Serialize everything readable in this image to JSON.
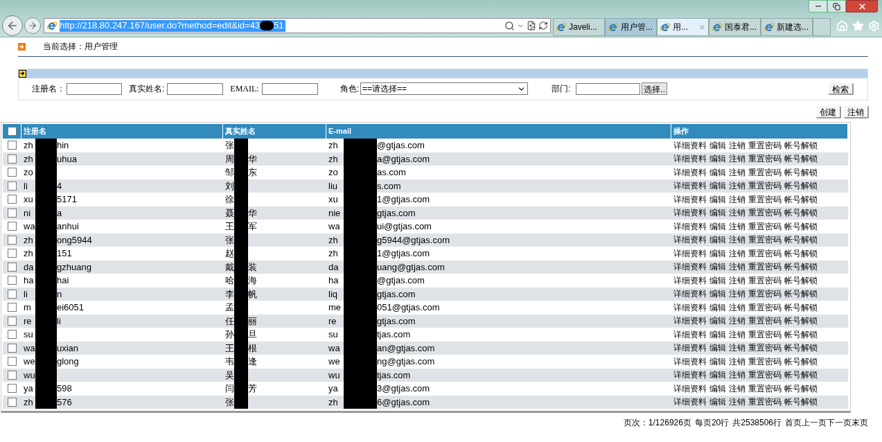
{
  "address_bar": {
    "url_before": "http://218.80.247.167/user.do?method=edit&id=43",
    "url_after": "51"
  },
  "tabs": [
    {
      "label": "Javeli...",
      "selected": false,
      "closable": false
    },
    {
      "label": "用户管...",
      "selected": false,
      "closable": false
    },
    {
      "label": "用...",
      "selected": true,
      "closable": true
    },
    {
      "label": "国泰君...",
      "selected": false,
      "closable": false
    },
    {
      "label": "新建选...",
      "selected": false,
      "closable": false
    }
  ],
  "breadcrumb": "当前选择：用户管理",
  "filters": [
    {
      "kind": "text",
      "label": "注册名："
    },
    {
      "kind": "text",
      "label": "真实姓名:"
    },
    {
      "kind": "text",
      "label": "EMAIL:"
    },
    {
      "kind": "select",
      "label": "角色:",
      "value": "==请选择=="
    },
    {
      "kind": "picker",
      "label": "部门:",
      "button": "选择.."
    }
  ],
  "search_button": "检索",
  "action_buttons": [
    "创建",
    "注销"
  ],
  "table": {
    "columns": [
      "注册名",
      "真实姓名",
      "E-mail",
      "操作"
    ],
    "header_checked": false,
    "rows": [
      {
        "checked": false,
        "cells": [
          {
            "before": "zh",
            "after": "hin"
          },
          {
            "before": "张"
          },
          {
            "before": "zh",
            "after": "@gtjas.com"
          }
        ],
        "actions": [
          "详细资料",
          "编辑",
          "注销",
          "重置密码",
          "帐号解锁"
        ]
      },
      {
        "checked": false,
        "cells": [
          {
            "before": "zh",
            "after": "uhua"
          },
          {
            "before": "周",
            "after": "华"
          },
          {
            "before": "zh",
            "after": "a@gtjas.com"
          }
        ],
        "actions": [
          "详细资料",
          "编辑",
          "注销",
          "重置密码",
          "帐号解锁"
        ]
      },
      {
        "checked": false,
        "cells": [
          {
            "before": "zo"
          },
          {
            "before": "邹",
            "after": "东"
          },
          {
            "before": "zo",
            "after": "as.com"
          }
        ],
        "actions": [
          "详细资料",
          "编辑",
          "注销",
          "重置密码",
          "帐号解锁"
        ]
      },
      {
        "checked": false,
        "cells": [
          {
            "before": "li",
            "after": "4"
          },
          {
            "before": "刘"
          },
          {
            "before": "liu",
            "after": "s.com"
          }
        ],
        "actions": [
          "详细资料",
          "编辑",
          "注销",
          "重置密码",
          "帐号解锁"
        ]
      },
      {
        "checked": false,
        "cells": [
          {
            "before": "xu",
            "after": "5171"
          },
          {
            "before": "徐"
          },
          {
            "before": "xu",
            "after": "1@gtjas.com"
          }
        ],
        "actions": [
          "详细资料",
          "编辑",
          "注销",
          "重置密码",
          "帐号解锁"
        ]
      },
      {
        "checked": false,
        "cells": [
          {
            "before": "ni",
            "after": "a"
          },
          {
            "before": "聂",
            "after": "华"
          },
          {
            "before": "nie",
            "after": "gtjas.com"
          }
        ],
        "actions": [
          "详细资料",
          "编辑",
          "注销",
          "重置密码",
          "帐号解锁"
        ]
      },
      {
        "checked": false,
        "cells": [
          {
            "before": "wa",
            "after": "anhui"
          },
          {
            "before": "王",
            "after": "军"
          },
          {
            "before": "wa",
            "after": "ui@gtjas.com"
          }
        ],
        "actions": [
          "详细资料",
          "编辑",
          "注销",
          "重置密码",
          "帐号解锁"
        ]
      },
      {
        "checked": false,
        "cells": [
          {
            "before": "zh",
            "after": "ong5944"
          },
          {
            "before": "张"
          },
          {
            "before": "zh",
            "after": "g5944@gtjas.com"
          }
        ],
        "actions": [
          "详细资料",
          "编辑",
          "注销",
          "重置密码",
          "帐号解锁"
        ]
      },
      {
        "checked": false,
        "cells": [
          {
            "before": "zh",
            "after": "151"
          },
          {
            "before": "赵"
          },
          {
            "before": "zh",
            "after": "1@gtjas.com"
          }
        ],
        "actions": [
          "详细资料",
          "编辑",
          "注销",
          "重置密码",
          "帐号解锁"
        ]
      },
      {
        "checked": false,
        "cells": [
          {
            "before": "da",
            "after": "gzhuang"
          },
          {
            "before": "戴",
            "after": "装"
          },
          {
            "before": "da",
            "after": "uang@gtjas.com"
          }
        ],
        "actions": [
          "详细资料",
          "编辑",
          "注销",
          "重置密码",
          "帐号解锁"
        ]
      },
      {
        "checked": false,
        "cells": [
          {
            "before": "ha",
            "after": "hai"
          },
          {
            "before": "哈",
            "after": "海"
          },
          {
            "before": "ha",
            "after": "@gtjas.com"
          }
        ],
        "actions": [
          "详细资料",
          "编辑",
          "注销",
          "重置密码",
          "帐号解锁"
        ]
      },
      {
        "checked": false,
        "cells": [
          {
            "before": "li",
            "after": "n"
          },
          {
            "before": "李",
            "after": "帆"
          },
          {
            "before": "liq",
            "after": "gtjas.com"
          }
        ],
        "actions": [
          "详细资料",
          "编辑",
          "注销",
          "重置密码",
          "帐号解锁"
        ]
      },
      {
        "checked": false,
        "cells": [
          {
            "before": "m",
            "after": "ei6051"
          },
          {
            "before": "孟"
          },
          {
            "before": "me",
            "after": "051@gtjas.com"
          }
        ],
        "actions": [
          "详细资料",
          "编辑",
          "注销",
          "重置密码",
          "帐号解锁"
        ]
      },
      {
        "checked": false,
        "cells": [
          {
            "before": "re",
            "after": "li"
          },
          {
            "before": "任",
            "after": "丽"
          },
          {
            "before": "re",
            "after": "gtjas.com"
          }
        ],
        "actions": [
          "详细资料",
          "编辑",
          "注销",
          "重置密码",
          "帐号解锁"
        ]
      },
      {
        "checked": false,
        "cells": [
          {
            "before": "su"
          },
          {
            "before": "孙",
            "after": "旦"
          },
          {
            "before": "su",
            "after": "tjas.com"
          }
        ],
        "actions": [
          "详细资料",
          "编辑",
          "注销",
          "重置密码",
          "帐号解锁"
        ]
      },
      {
        "checked": false,
        "cells": [
          {
            "before": "wa",
            "after": "uxian"
          },
          {
            "before": "王",
            "after": "根"
          },
          {
            "before": "wa",
            "after": "an@gtjas.com"
          }
        ],
        "actions": [
          "详细资料",
          "编辑",
          "注销",
          "重置密码",
          "帐号解锁"
        ]
      },
      {
        "checked": false,
        "cells": [
          {
            "before": "we",
            "after": "glong"
          },
          {
            "before": "韦",
            "after": "逢"
          },
          {
            "before": "we",
            "after": "ng@gtjas.com"
          }
        ],
        "actions": [
          "详细资料",
          "编辑",
          "注销",
          "重置密码",
          "帐号解锁"
        ]
      },
      {
        "checked": false,
        "cells": [
          {
            "before": "wu"
          },
          {
            "before": "吴"
          },
          {
            "before": "wu",
            "after": "tjas.com"
          }
        ],
        "actions": [
          "详细资料",
          "编辑",
          "注销",
          "重置密码",
          "帐号解锁"
        ]
      },
      {
        "checked": false,
        "cells": [
          {
            "before": "ya",
            "after": "598"
          },
          {
            "before": "闫",
            "after": "芳"
          },
          {
            "before": "ya",
            "after": "3@gtjas.com"
          }
        ],
        "actions": [
          "详细资料",
          "编辑",
          "注销",
          "重置密码",
          "帐号解锁"
        ]
      },
      {
        "checked": false,
        "cells": [
          {
            "before": "zh",
            "after": "576"
          },
          {
            "before": "张"
          },
          {
            "before": "zh",
            "after": "6@gtjas.com"
          }
        ],
        "actions": [
          "详细资料",
          "编辑",
          "注销",
          "重置密码",
          "帐号解锁"
        ]
      }
    ]
  },
  "pagination": {
    "info": [
      "页次：1/126926页",
      "每页20行",
      "共2538506行"
    ],
    "links": [
      "首页",
      "上一页",
      "下一页",
      "末页"
    ]
  }
}
